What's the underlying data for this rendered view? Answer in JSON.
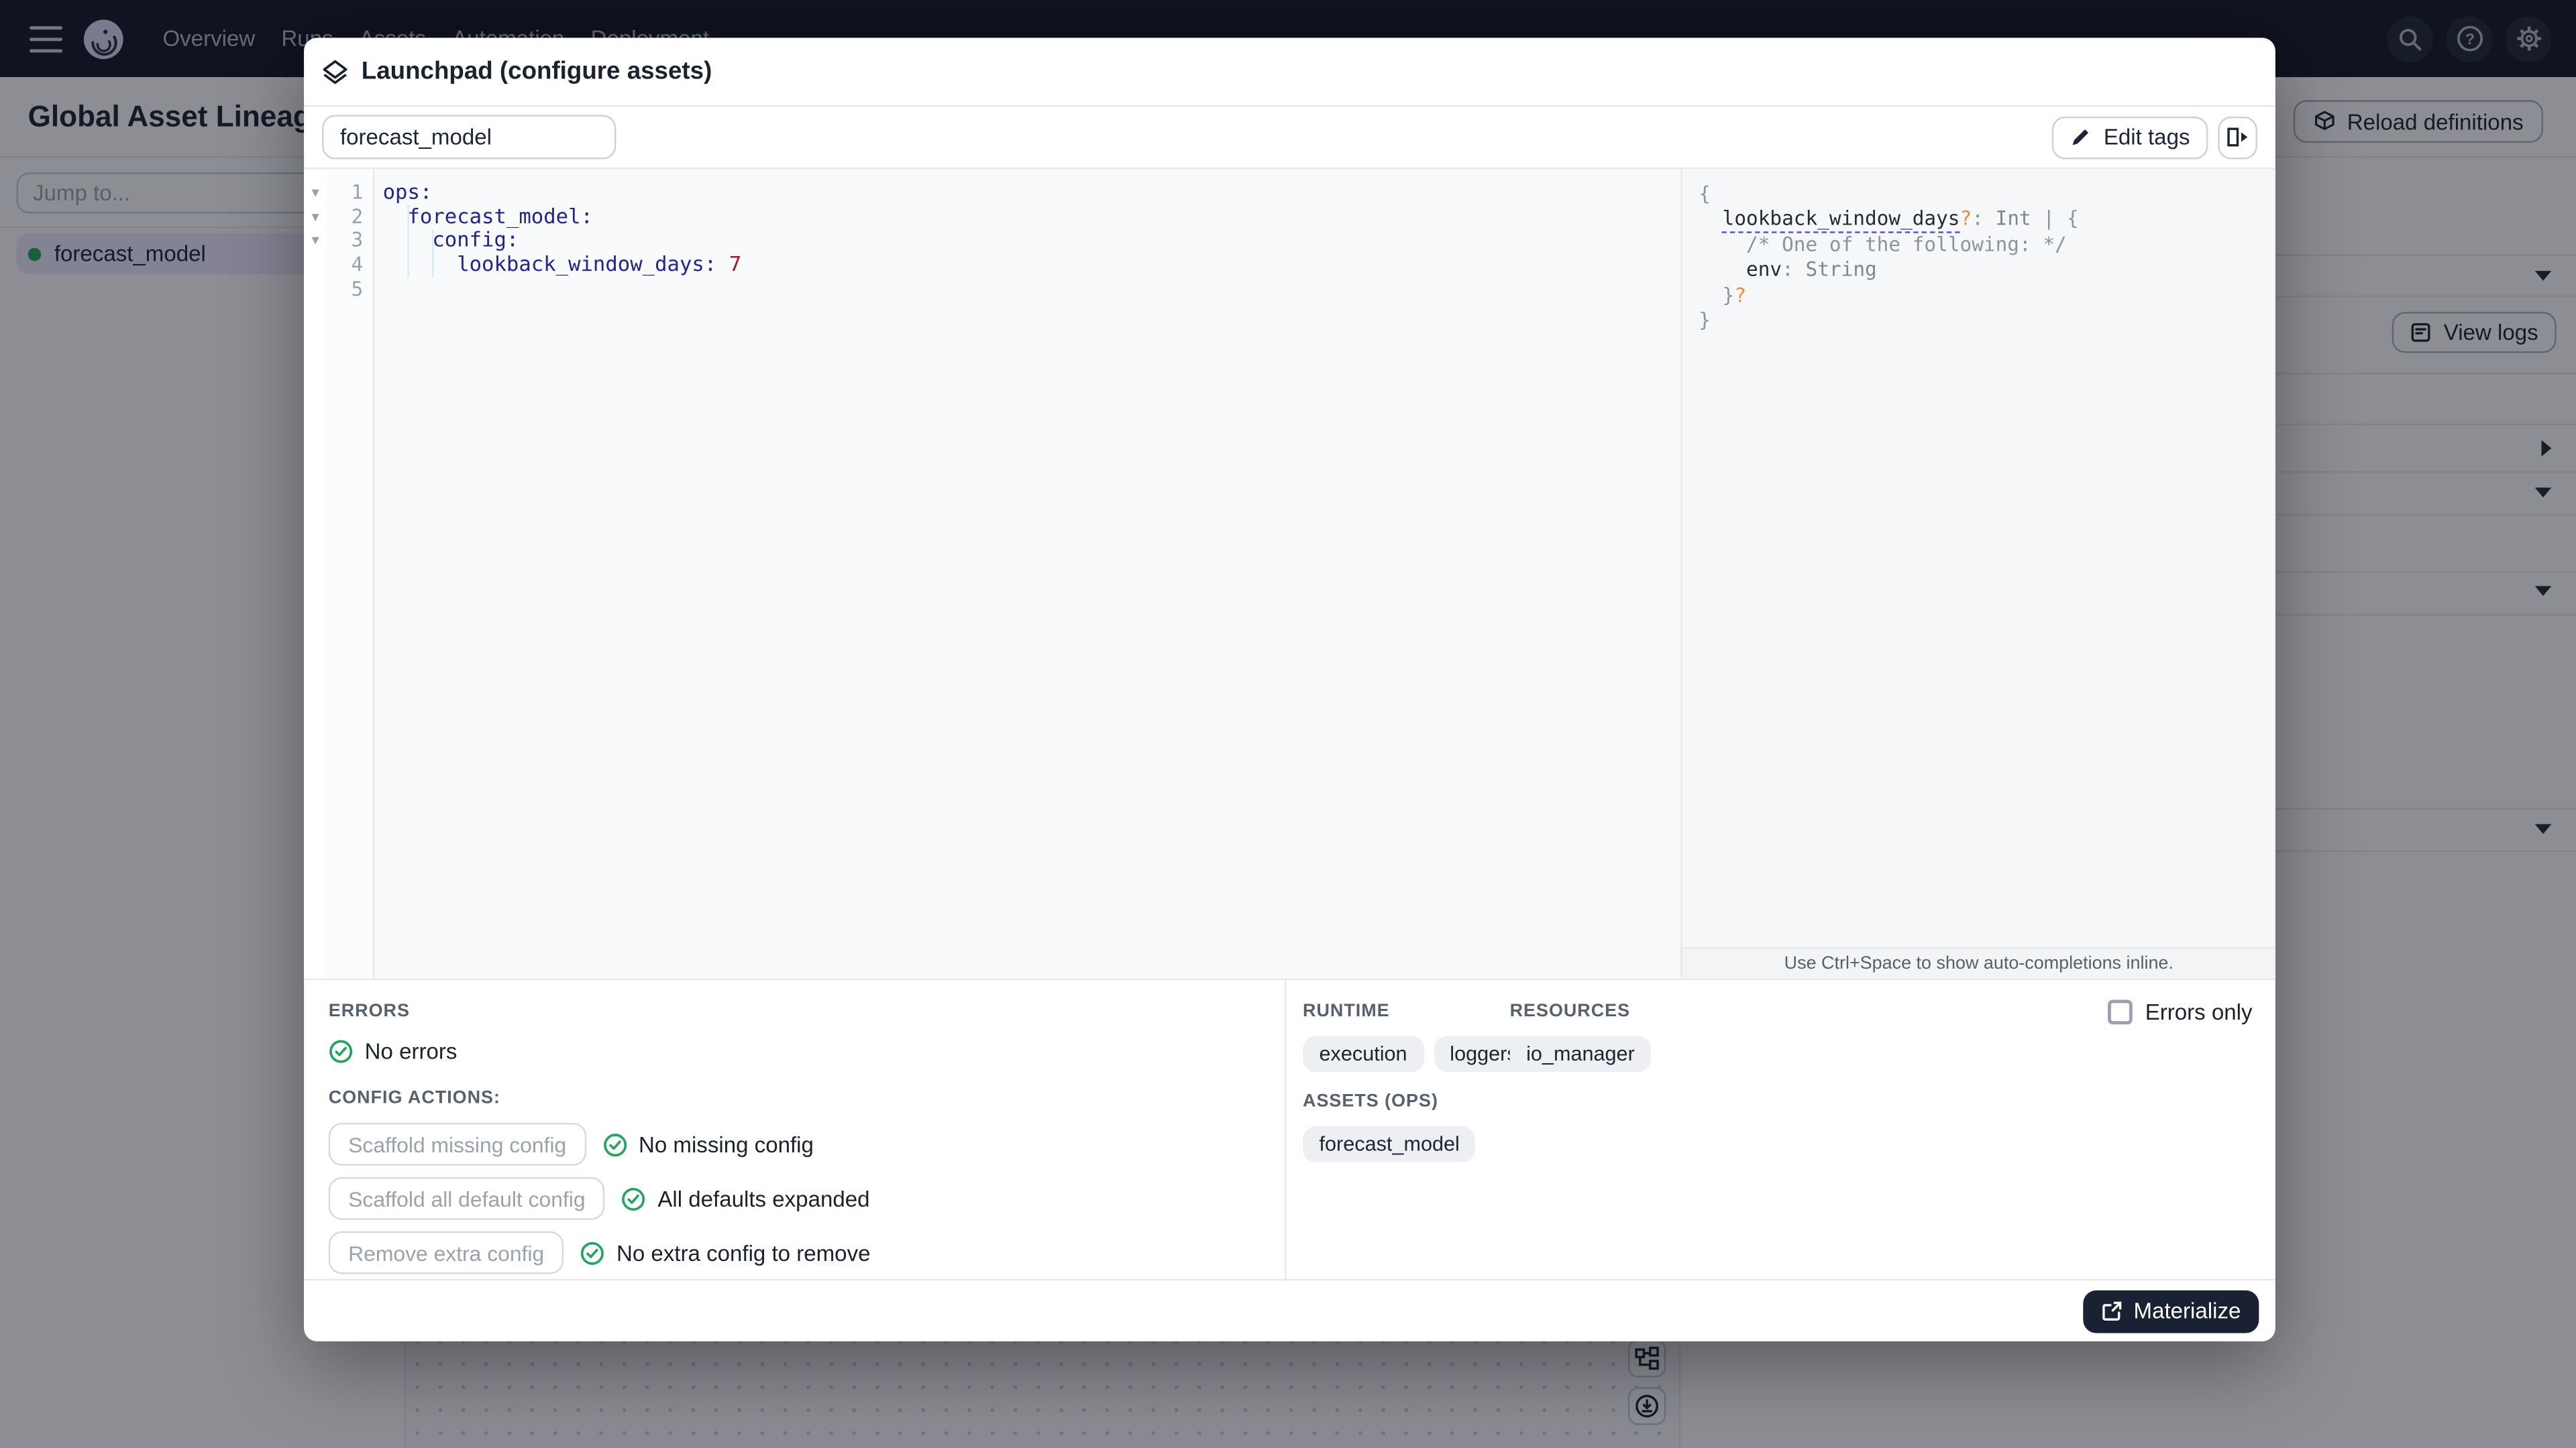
{
  "nav": {
    "items": [
      "Overview",
      "Runs",
      "Assets",
      "Automation",
      "Deployment"
    ]
  },
  "page_header": {
    "title": "Global Asset Lineage",
    "reload_button": "Reload definitions"
  },
  "lineage_sidebar": {
    "jump_placeholder": "Jump to...",
    "selected_asset": "forecast_model",
    "asset_status_color": "#21A456"
  },
  "asset_details_panel": {
    "view_logs_button": "View logs"
  },
  "launchpad": {
    "title": "Launchpad (configure assets)",
    "op_selector_value": "forecast_model",
    "edit_tags_button": "Edit tags",
    "editor": {
      "line_numbers": [
        1,
        2,
        3,
        4,
        5
      ],
      "foldable_lines": [
        1,
        2,
        3
      ],
      "lines": [
        [
          {
            "t": "ops:",
            "c": "key"
          }
        ],
        [
          {
            "t": "  ",
            "c": ""
          },
          {
            "t": "forecast_model:",
            "c": "key"
          }
        ],
        [
          {
            "t": "    ",
            "c": ""
          },
          {
            "t": "config:",
            "c": "key"
          }
        ],
        [
          {
            "t": "      ",
            "c": ""
          },
          {
            "t": "lookback_window_days:",
            "c": "key"
          },
          {
            "t": " ",
            "c": ""
          },
          {
            "t": "7",
            "c": "num"
          }
        ],
        []
      ]
    },
    "schema": {
      "lines": [
        [
          {
            "t": "{",
            "c": "p"
          }
        ],
        [
          {
            "t": "  ",
            "c": ""
          },
          {
            "t": "lookback_window_days",
            "c": "key underline"
          },
          {
            "t": "?",
            "c": "opt"
          },
          {
            "t": ": ",
            "c": "p"
          },
          {
            "t": "Int",
            "c": "type"
          },
          {
            "t": " | ",
            "c": "p"
          },
          {
            "t": "{",
            "c": "p"
          }
        ],
        [
          {
            "t": "    ",
            "c": ""
          },
          {
            "t": "/* One of the following: */",
            "c": "comment"
          }
        ],
        [
          {
            "t": "    ",
            "c": ""
          },
          {
            "t": "env",
            "c": "key"
          },
          {
            "t": ": ",
            "c": "p"
          },
          {
            "t": "String",
            "c": "type"
          }
        ],
        [
          {
            "t": "  ",
            "c": ""
          },
          {
            "t": "}",
            "c": "p"
          },
          {
            "t": "?",
            "c": "opt"
          }
        ],
        [
          {
            "t": "}",
            "c": "p"
          }
        ]
      ],
      "hint": "Use Ctrl+Space to show auto-completions inline."
    },
    "errors_section": {
      "heading": "ERRORS",
      "status": "No errors"
    },
    "config_actions": {
      "heading": "CONFIG ACTIONS:",
      "rows": [
        {
          "button": "Scaffold missing config",
          "status": "No missing config"
        },
        {
          "button": "Scaffold all default config",
          "status": "All defaults expanded"
        },
        {
          "button": "Remove extra config",
          "status": "No extra config to remove"
        }
      ]
    },
    "runtime_section": {
      "heading": "RUNTIME",
      "tags": [
        "execution",
        "loggers"
      ]
    },
    "resources_section": {
      "heading": "RESOURCES",
      "tags": [
        "io_manager"
      ]
    },
    "assets_section": {
      "heading": "ASSETS (OPS)",
      "tags": [
        "forecast_model"
      ]
    },
    "errors_only_label": "Errors only",
    "errors_only_checked": false,
    "materialize_button": "Materialize"
  },
  "colors": {
    "accent_green": "#23a55f",
    "key_indigo": "#20248e",
    "value_red": "#9e1c23",
    "optional_orange": "#ef8d3e",
    "schema_underline_blue": "#5353e0",
    "materialize_bg": "#1a2133",
    "backdrop": "rgba(12,14,22,0.45)"
  }
}
